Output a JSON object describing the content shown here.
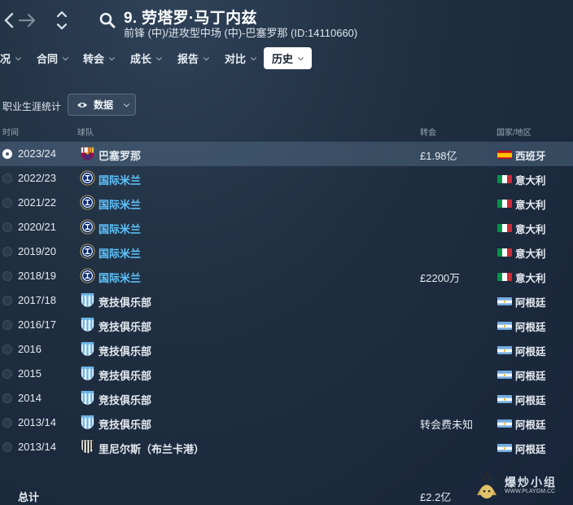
{
  "header": {
    "title": "9. 劳塔罗·马丁内兹",
    "subtitle": "前锋 (中)/进攻型中场 (中)-巴塞罗那 (ID:14110660)"
  },
  "tabs": [
    {
      "label": "况",
      "active": false
    },
    {
      "label": "合同",
      "active": false
    },
    {
      "label": "转会",
      "active": false
    },
    {
      "label": "成长",
      "active": false
    },
    {
      "label": "报告",
      "active": false
    },
    {
      "label": "对比",
      "active": false
    },
    {
      "label": "历史",
      "active": true
    }
  ],
  "toolbar": {
    "section_label": "职业生涯统计",
    "view_label": "数据"
  },
  "table": {
    "columns": {
      "season": "时间",
      "club": "球队",
      "fee": "转会",
      "nation": "国家/地区"
    },
    "rows": [
      {
        "season": "2023/24",
        "club": "巴塞罗那",
        "crest": "barcelona-crest",
        "fee": "£1.98亿",
        "flag": "spain-flag",
        "nation": "西班牙",
        "selected": true,
        "link": false
      },
      {
        "season": "2022/23",
        "club": "国际米兰",
        "crest": "inter-crest",
        "fee": "",
        "flag": "italy-flag",
        "nation": "意大利",
        "selected": false,
        "link": true
      },
      {
        "season": "2021/22",
        "club": "国际米兰",
        "crest": "inter-crest",
        "fee": "",
        "flag": "italy-flag",
        "nation": "意大利",
        "selected": false,
        "link": true
      },
      {
        "season": "2020/21",
        "club": "国际米兰",
        "crest": "inter-crest",
        "fee": "",
        "flag": "italy-flag",
        "nation": "意大利",
        "selected": false,
        "link": true
      },
      {
        "season": "2019/20",
        "club": "国际米兰",
        "crest": "inter-crest",
        "fee": "",
        "flag": "italy-flag",
        "nation": "意大利",
        "selected": false,
        "link": true
      },
      {
        "season": "2018/19",
        "club": "国际米兰",
        "crest": "inter-crest",
        "fee": "£2200万",
        "flag": "italy-flag",
        "nation": "意大利",
        "selected": false,
        "link": true
      },
      {
        "season": "2017/18",
        "club": "竞技俱乐部",
        "crest": "racing-crest",
        "fee": "",
        "flag": "argentina-flag",
        "nation": "阿根廷",
        "selected": false,
        "link": false
      },
      {
        "season": "2016/17",
        "club": "竞技俱乐部",
        "crest": "racing-crest",
        "fee": "",
        "flag": "argentina-flag",
        "nation": "阿根廷",
        "selected": false,
        "link": false
      },
      {
        "season": "2016",
        "club": "竞技俱乐部",
        "crest": "racing-crest",
        "fee": "",
        "flag": "argentina-flag",
        "nation": "阿根廷",
        "selected": false,
        "link": false
      },
      {
        "season": "2015",
        "club": "竞技俱乐部",
        "crest": "racing-crest",
        "fee": "",
        "flag": "argentina-flag",
        "nation": "阿根廷",
        "selected": false,
        "link": false
      },
      {
        "season": "2014",
        "club": "竞技俱乐部",
        "crest": "racing-crest",
        "fee": "",
        "flag": "argentina-flag",
        "nation": "阿根廷",
        "selected": false,
        "link": false
      },
      {
        "season": "2013/14",
        "club": "竞技俱乐部",
        "crest": "racing-crest",
        "fee": "转会费未知",
        "flag": "argentina-flag",
        "nation": "阿根廷",
        "selected": false,
        "link": false
      },
      {
        "season": "2013/14",
        "club": "里尼尔斯（布兰卡港）",
        "crest": "liniers-crest",
        "fee": "",
        "flag": "argentina-flag",
        "nation": "阿根廷",
        "selected": false,
        "link": false
      }
    ],
    "total_label": "总计",
    "total_value": "£2.2亿"
  },
  "watermark": {
    "text": "爆炒小组",
    "sub": "WWW.PLAYGM.CC"
  },
  "colors": {
    "link": "#5ec5ff",
    "active_tab_bg": "#ffffff",
    "selected_row": "#4f6a86"
  }
}
